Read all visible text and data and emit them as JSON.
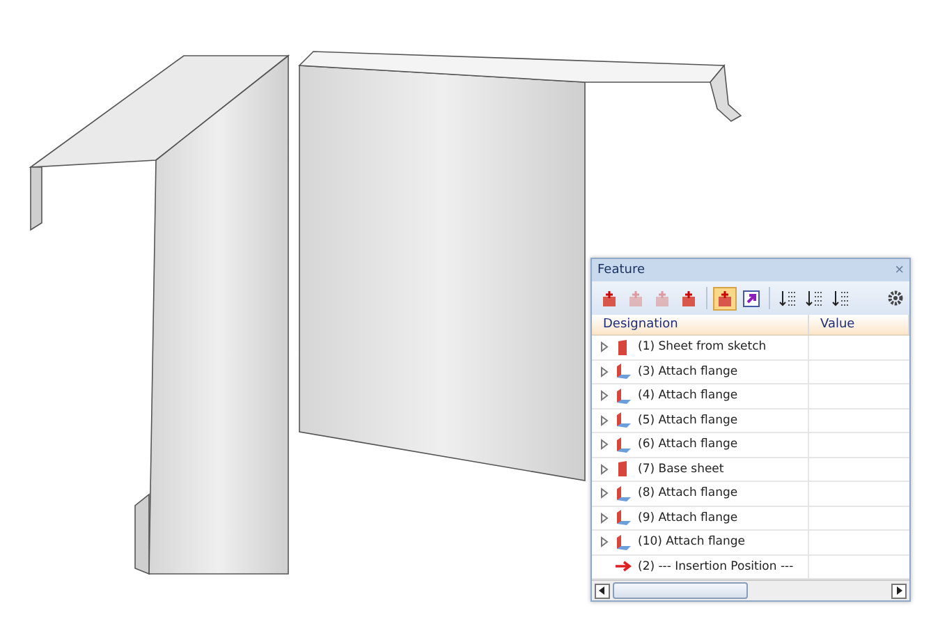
{
  "panel": {
    "title": "Feature",
    "close": "×"
  },
  "toolbar": [
    {
      "kind": "add",
      "selected": false,
      "disabled": false
    },
    {
      "kind": "add",
      "selected": false,
      "disabled": true
    },
    {
      "kind": "add",
      "selected": false,
      "disabled": true
    },
    {
      "kind": "add",
      "selected": false,
      "disabled": false
    },
    {
      "kind": "add",
      "selected": true,
      "disabled": false
    },
    {
      "kind": "jump",
      "selected": false,
      "disabled": false
    },
    {
      "kind": "sort",
      "selected": false,
      "disabled": false
    },
    {
      "kind": "sort",
      "selected": false,
      "disabled": false
    },
    {
      "kind": "sort",
      "selected": false,
      "disabled": false
    }
  ],
  "table": {
    "columns": [
      "Designation",
      "Value"
    ],
    "rows": [
      {
        "kind": "sheet",
        "label": "(1) Sheet from sketch",
        "expandable": true
      },
      {
        "kind": "flange",
        "label": "(3) Attach flange",
        "expandable": true
      },
      {
        "kind": "flange",
        "label": "(4) Attach flange",
        "expandable": true
      },
      {
        "kind": "flange",
        "label": "(5) Attach flange",
        "expandable": true
      },
      {
        "kind": "flange",
        "label": "(6) Attach flange",
        "expandable": true
      },
      {
        "kind": "sheet",
        "label": "(7) Base sheet",
        "expandable": true
      },
      {
        "kind": "flange",
        "label": "(8) Attach flange",
        "expandable": true
      },
      {
        "kind": "flange",
        "label": "(9) Attach flange",
        "expandable": true
      },
      {
        "kind": "flange",
        "label": "(10) Attach flange",
        "expandable": true
      },
      {
        "kind": "insertion",
        "label": "(2) --- Insertion Position ---",
        "expandable": false
      }
    ]
  }
}
